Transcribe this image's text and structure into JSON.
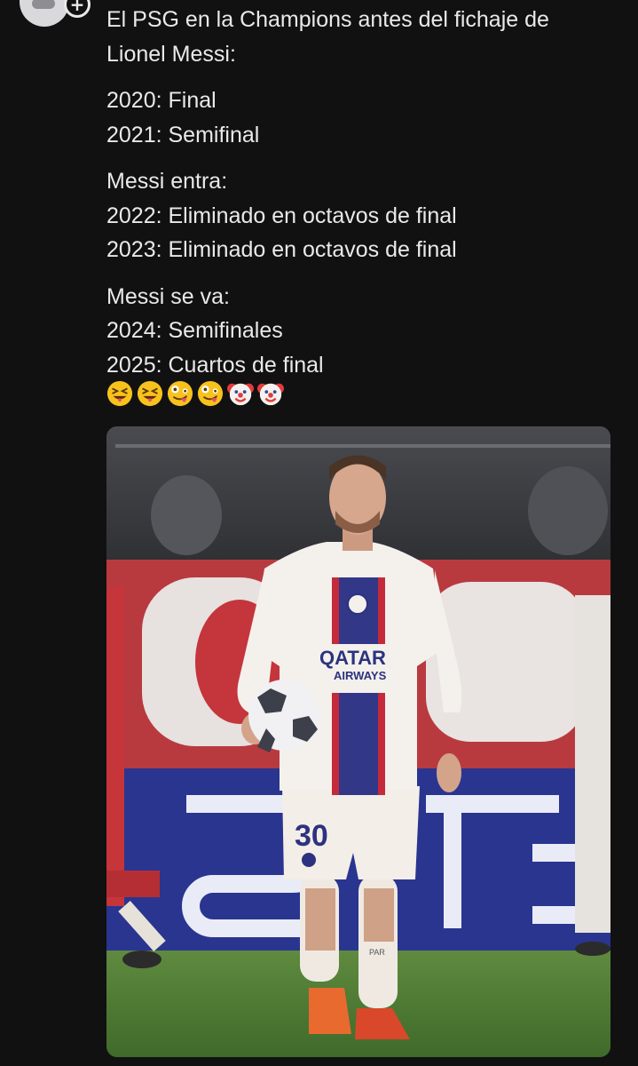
{
  "post": {
    "title": "El PSG en la Champions antes del fichaje de",
    "title_cont": "Lionel Messi:",
    "before": [
      "2020: Final",
      "2021: Semifinal"
    ],
    "during_heading": "Messi entra:",
    "during": [
      "2022: Eliminado en octavos de final",
      "2023: Eliminado en octavos de final"
    ],
    "after_heading": "Messi se va:",
    "after": [
      "2024: Semifinales",
      "2025: Cuartos de final"
    ],
    "emojis": [
      "squinting-tongue",
      "squinting-tongue",
      "zany-face",
      "zany-face",
      "clown-face",
      "clown-face"
    ]
  },
  "photo": {
    "jersey_sponsor_line1": "QATAR",
    "jersey_sponsor_line2": "AIRWAYS",
    "shorts_number": "30",
    "sock_text": "PAR"
  },
  "colors": {
    "background": "#111112",
    "text": "#e9e9ea",
    "jersey_blue": "#33388a",
    "jersey_red": "#c42a3a",
    "pitch": "#4f7a36"
  }
}
